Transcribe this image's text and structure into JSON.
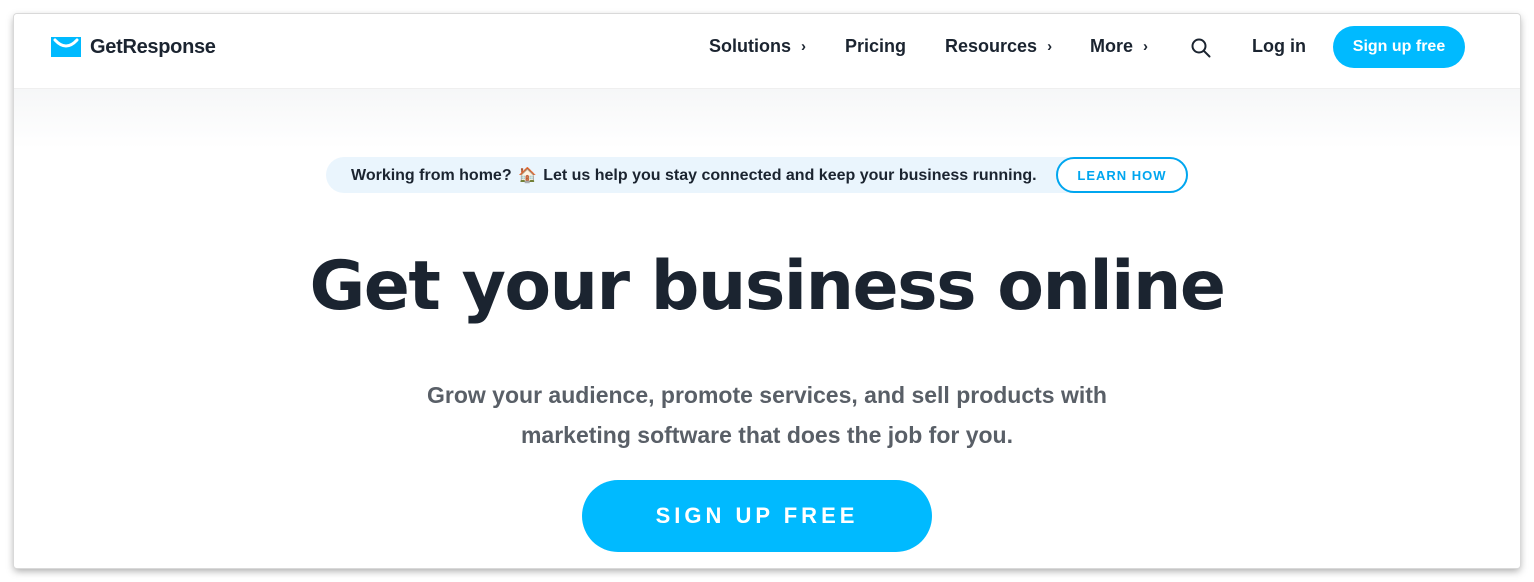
{
  "brand": {
    "name": "GetResponse",
    "color": "#00baff"
  },
  "nav": {
    "items": [
      {
        "label": "Solutions",
        "has_chevron": true
      },
      {
        "label": "Pricing",
        "has_chevron": false
      },
      {
        "label": "Resources",
        "has_chevron": true
      },
      {
        "label": "More",
        "has_chevron": true
      }
    ],
    "chevron": "›",
    "search_icon": "search-icon",
    "login_label": "Log in",
    "signup_label": "Sign up free"
  },
  "banner": {
    "text_before": "Working from home?",
    "icon": "house-icon",
    "icon_glyph": "🏠",
    "text_after": "Let us help you stay connected and keep your business running.",
    "button_label": "LEARN HOW"
  },
  "hero": {
    "headline": "Get your business online",
    "subtext_line1": "Grow your audience, promote services, and sell products with",
    "subtext_line2": "marketing software that does the job for you.",
    "cta_label": "SIGN UP FREE"
  },
  "colors": {
    "accent": "#00baff",
    "text_dark": "#1b2430",
    "text_muted": "#595f67",
    "banner_bg": "#eaf5fd"
  }
}
